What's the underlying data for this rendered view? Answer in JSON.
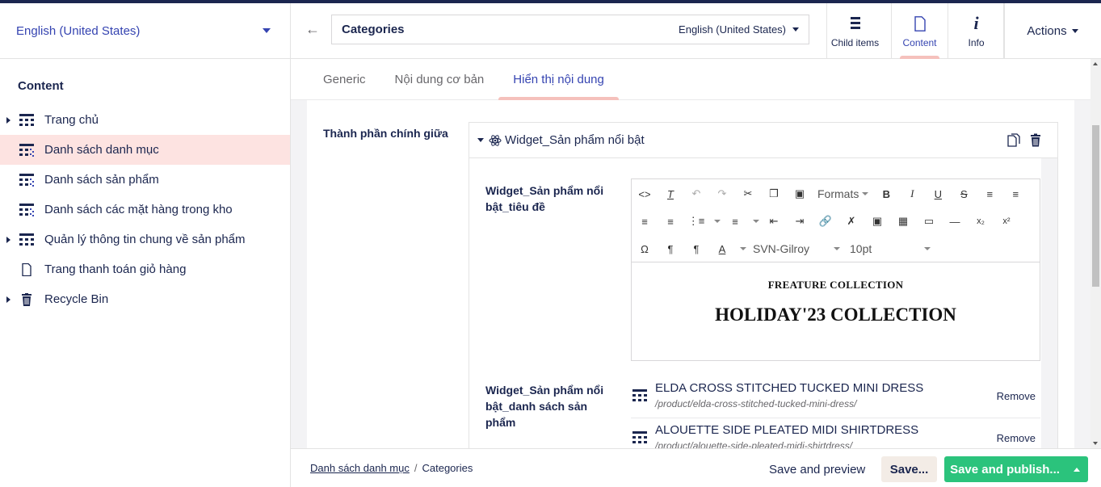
{
  "colors": {
    "accent": "#3544b1",
    "active_bg": "#fde3e1",
    "publish": "#2bc37c",
    "header_line": "#1b264f"
  },
  "sidebar": {
    "language": "English (United States)",
    "section_title": "Content",
    "items": [
      {
        "label": "Trang chủ",
        "icon": "doc-type-grid-icon",
        "has_children": true
      },
      {
        "label": "Danh sách danh mục",
        "icon": "list-view-icon",
        "has_children": false,
        "active": true
      },
      {
        "label": "Danh sách sản phẩm",
        "icon": "list-view-icon",
        "has_children": false
      },
      {
        "label": "Danh sách các mặt hàng trong kho",
        "icon": "list-view-icon",
        "has_children": false
      },
      {
        "label": "Quản lý thông tin chung về sản phẩm",
        "icon": "doc-type-grid-icon",
        "has_children": true
      },
      {
        "label": "Trang thanh toán giỏ hàng",
        "icon": "document-icon",
        "has_children": false
      },
      {
        "label": "Recycle Bin",
        "icon": "trash-icon",
        "has_children": true
      }
    ]
  },
  "header": {
    "node_name": "Categories",
    "variant": "English (United States)",
    "apps": [
      {
        "label": "Child items",
        "icon": "list-icon"
      },
      {
        "label": "Content",
        "icon": "document-icon",
        "active": true
      },
      {
        "label": "Info",
        "icon": "info-icon"
      }
    ],
    "actions_label": "Actions"
  },
  "tabs": [
    {
      "label": "Generic"
    },
    {
      "label": "Nội dung cơ bản"
    },
    {
      "label": "Hiển thị nội dung",
      "active": true
    }
  ],
  "content": {
    "property_label": "Thành phần chính giữa",
    "block_title": "Widget_Sản phẩm nổi bật",
    "field_title_label": "Widget_Sản phẩm nổi bật_tiêu đề",
    "editor": {
      "formats_label": "Formats",
      "font_family": "SVN-Gilroy",
      "font_size": "10pt",
      "heading_small": "FREATURE COLLECTION",
      "heading_big": "HOLIDAY'23 COLLECTION"
    },
    "field_products_label": "Widget_Sản phẩm nổi bật_danh sách sản phẩm",
    "products": [
      {
        "name": "ELDA CROSS STITCHED TUCKED MINI DRESS",
        "url": "/product/elda-cross-stitched-tucked-mini-dress/",
        "remove_label": "Remove"
      },
      {
        "name": "ALOUETTE SIDE PLEATED MIDI SHIRTDRESS",
        "url": "/product/alouette-side-pleated-midi-shirtdress/",
        "remove_label": "Remove"
      }
    ]
  },
  "footer": {
    "breadcrumb_parent": "Danh sách danh mục",
    "breadcrumb_current": "Categories",
    "preview_label": "Save and preview",
    "save_label": "Save...",
    "publish_label": "Save and publish..."
  }
}
